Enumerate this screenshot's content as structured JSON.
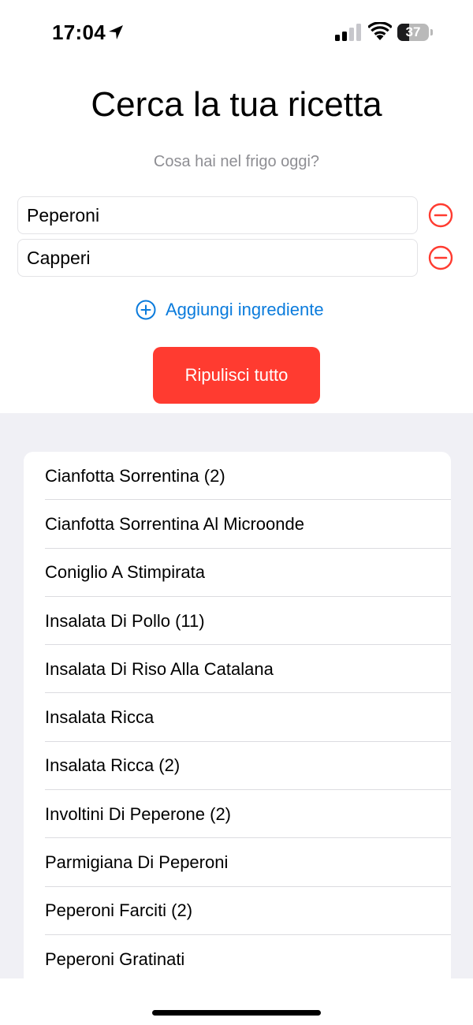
{
  "status_bar": {
    "time": "17:04",
    "battery_text": "37",
    "battery_level": 0.37,
    "icons": [
      "location-arrow-icon",
      "cellular-signal-icon",
      "wifi-icon",
      "battery-icon"
    ]
  },
  "header": {
    "title": "Cerca la tua ricetta",
    "subtitle": "Cosa hai nel frigo oggi?"
  },
  "ingredients": [
    {
      "value": "Peperoni",
      "remove_icon": "minus-circle-icon"
    },
    {
      "value": "Capperi",
      "remove_icon": "minus-circle-icon"
    }
  ],
  "add_ingredient": {
    "label": "Aggiungi ingrediente",
    "icon": "plus-circle-icon"
  },
  "clear_button": {
    "label": "Ripulisci tutto"
  },
  "results": [
    "Cianfotta Sorrentina (2)",
    "Cianfotta Sorrentina Al Microonde",
    "Coniglio A Stimpirata",
    "Insalata Di Pollo (11)",
    "Insalata Di Riso Alla Catalana",
    "Insalata Ricca",
    "Insalata Ricca (2)",
    "Involtini Di Peperone (2)",
    "Parmigiana Di Peperoni",
    "Peperoni Farciti (2)",
    "Peperoni Gratinati"
  ],
  "colors": {
    "accent": "#0a7bdc",
    "destructive": "#ff3b30",
    "secondary_text": "#8e8e93",
    "grouped_background": "#f0f0f5"
  }
}
